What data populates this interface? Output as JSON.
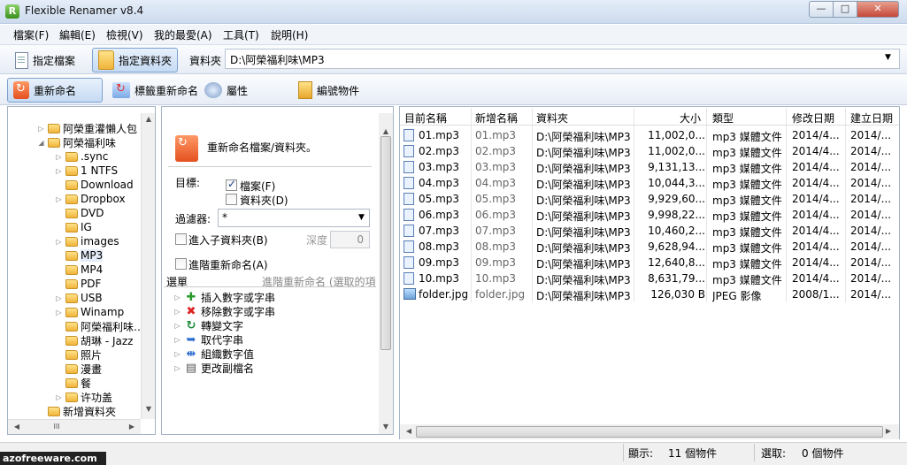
{
  "window": {
    "title": "Flexible Renamer v8.4",
    "minimize": "—",
    "maximize": "□",
    "close": "✕"
  },
  "app_icon": "R",
  "menu": [
    "檔案(F)",
    "編輯(E)",
    "檢視(V)",
    "我的最愛(A)",
    "工具(T)",
    "說明(H)"
  ],
  "toolbar1": {
    "file_button": "指定檔案",
    "folder_button": "指定資料夾",
    "folder_label": "資料夾",
    "path": "D:\\阿榮福利味\\MP3"
  },
  "toolbar2": {
    "rename": "重新命名",
    "tag_rename": "標籤重新命名",
    "properties": "屬性",
    "numbering": "編號物件"
  },
  "tree": [
    {
      "label": "阿榮重灌懶人包",
      "expander": "▷"
    },
    {
      "label": "阿榮福利味",
      "expander": "◢"
    },
    {
      "label": ".sync",
      "expander": "▷"
    },
    {
      "label": "1 NTFS",
      "expander": "▷"
    },
    {
      "label": "Download",
      "expander": ""
    },
    {
      "label": "Dropbox",
      "expander": "▷"
    },
    {
      "label": "DVD",
      "expander": ""
    },
    {
      "label": "IG",
      "expander": ""
    },
    {
      "label": "images",
      "expander": "▷"
    },
    {
      "label": "MP3",
      "expander": ""
    },
    {
      "label": "MP4",
      "expander": ""
    },
    {
      "label": "PDF",
      "expander": ""
    },
    {
      "label": "USB",
      "expander": "▷"
    },
    {
      "label": "Winamp",
      "expander": "▷"
    },
    {
      "label": "阿榮福利味…",
      "expander": ""
    },
    {
      "label": "胡琳 - Jazz",
      "expander": ""
    },
    {
      "label": "照片",
      "expander": ""
    },
    {
      "label": "漫畫",
      "expander": ""
    },
    {
      "label": "餐",
      "expander": ""
    },
    {
      "label": "许功盖",
      "expander": "▷"
    },
    {
      "label": "新增資料夾",
      "expander": ""
    }
  ],
  "settings": {
    "description": "重新命名檔案/資料夾。",
    "target_label": "目標:",
    "files_label": "檔案(F)",
    "folders_label": "資料夾(D)",
    "filter_label": "過濾器:",
    "filter_value": "*",
    "subfolders_label": "進入子資料夾(B)",
    "depth_label": "深度",
    "depth_value": "0",
    "advanced_label": "進階重新命名(A)",
    "list_label": "選單",
    "list_hint": "進階重新命名 (選取的項",
    "operations": [
      {
        "label": "插入數字或字串",
        "icon": "plus-icon"
      },
      {
        "label": "移除數字或字串",
        "icon": "cross-icon"
      },
      {
        "label": "轉變文字",
        "icon": "convert-icon"
      },
      {
        "label": "取代字串",
        "icon": "replace-icon"
      },
      {
        "label": "組織數字值",
        "icon": "organize-icon"
      },
      {
        "label": "更改副檔名",
        "icon": "extension-icon"
      }
    ]
  },
  "files": {
    "columns": [
      "目前名稱",
      "新增名稱",
      "資料夾",
      "大小",
      "類型",
      "修改日期",
      "建立日期"
    ],
    "rows": [
      {
        "cur": "01.mp3",
        "new": "01.mp3",
        "folder": "D:\\阿榮福利味\\MP3",
        "size": "11,002,0...",
        "type": "mp3 媒體文件",
        "mod": "2014/4...",
        "created": "2014/..."
      },
      {
        "cur": "02.mp3",
        "new": "02.mp3",
        "folder": "D:\\阿榮福利味\\MP3",
        "size": "11,002,0...",
        "type": "mp3 媒體文件",
        "mod": "2014/4...",
        "created": "2014/..."
      },
      {
        "cur": "03.mp3",
        "new": "03.mp3",
        "folder": "D:\\阿榮福利味\\MP3",
        "size": "9,131,13...",
        "type": "mp3 媒體文件",
        "mod": "2014/4...",
        "created": "2014/..."
      },
      {
        "cur": "04.mp3",
        "new": "04.mp3",
        "folder": "D:\\阿榮福利味\\MP3",
        "size": "10,044,3...",
        "type": "mp3 媒體文件",
        "mod": "2014/4...",
        "created": "2014/..."
      },
      {
        "cur": "05.mp3",
        "new": "05.mp3",
        "folder": "D:\\阿榮福利味\\MP3",
        "size": "9,929,60...",
        "type": "mp3 媒體文件",
        "mod": "2014/4...",
        "created": "2014/..."
      },
      {
        "cur": "06.mp3",
        "new": "06.mp3",
        "folder": "D:\\阿榮福利味\\MP3",
        "size": "9,998,22...",
        "type": "mp3 媒體文件",
        "mod": "2014/4...",
        "created": "2014/..."
      },
      {
        "cur": "07.mp3",
        "new": "07.mp3",
        "folder": "D:\\阿榮福利味\\MP3",
        "size": "10,460,2...",
        "type": "mp3 媒體文件",
        "mod": "2014/4...",
        "created": "2014/..."
      },
      {
        "cur": "08.mp3",
        "new": "08.mp3",
        "folder": "D:\\阿榮福利味\\MP3",
        "size": "9,628,94...",
        "type": "mp3 媒體文件",
        "mod": "2014/4...",
        "created": "2014/..."
      },
      {
        "cur": "09.mp3",
        "new": "09.mp3",
        "folder": "D:\\阿榮福利味\\MP3",
        "size": "12,640,8...",
        "type": "mp3 媒體文件",
        "mod": "2014/4...",
        "created": "2014/..."
      },
      {
        "cur": "10.mp3",
        "new": "10.mp3",
        "folder": "D:\\阿榮福利味\\MP3",
        "size": "8,631,79...",
        "type": "mp3 媒體文件",
        "mod": "2014/4...",
        "created": "2014/..."
      },
      {
        "cur": "folder.jpg",
        "new": "folder.jpg",
        "folder": "D:\\阿榮福利味\\MP3",
        "size": "126,030 B",
        "type": "JPEG 影像",
        "mod": "2008/1...",
        "created": "2014/..."
      }
    ]
  },
  "status": {
    "shown_label": "顯示:",
    "shown_value": "11 個物件",
    "selected_label": "選取:",
    "selected_value": "0 個物件"
  },
  "watermark": "azofreeware.com",
  "scroll": {
    "up": "▲",
    "down": "▼",
    "left": "◀",
    "right": "▶",
    "grip": "III"
  },
  "colors": {
    "accent": "#7da2ce",
    "selection": "#e3ecf8"
  }
}
